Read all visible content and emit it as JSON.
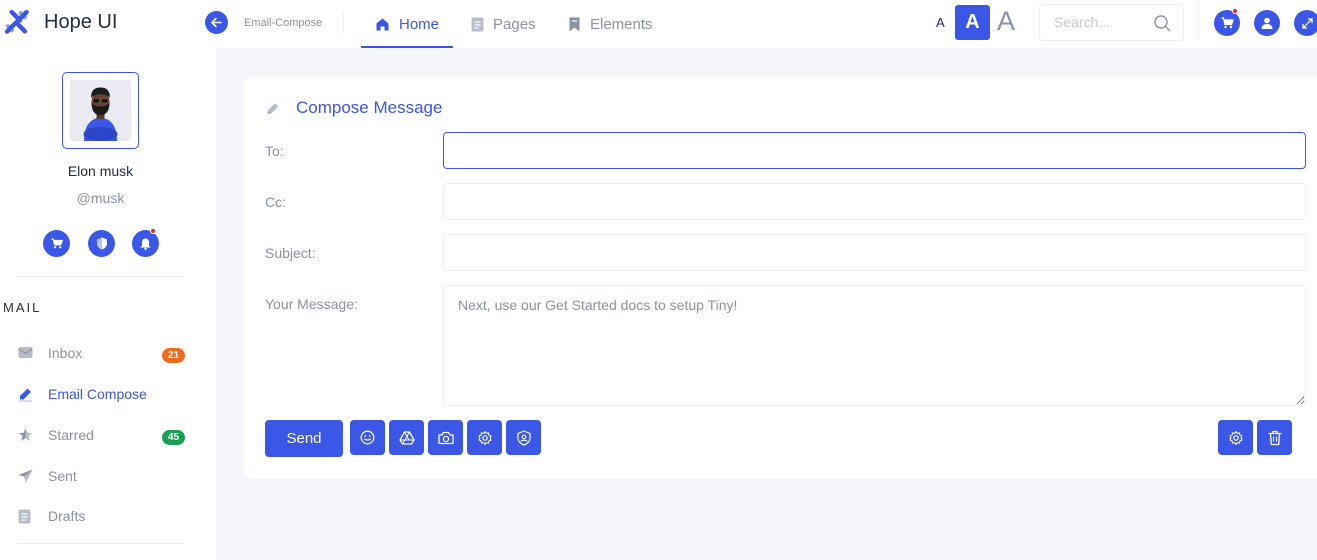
{
  "header": {
    "brand": "Hope UI",
    "breadcrumb": "Email-Compose",
    "tabs": [
      {
        "label": "Home",
        "active": true
      },
      {
        "label": "Pages",
        "active": false
      },
      {
        "label": "Elements",
        "active": false
      }
    ],
    "font_sizes": [
      "A",
      "A",
      "A"
    ],
    "search_placeholder": "Search..."
  },
  "profile": {
    "name": "Elon musk",
    "handle": "@musk"
  },
  "mail": {
    "heading": "MAIL",
    "items": [
      {
        "label": "Inbox",
        "icon": "inbox-icon",
        "badge": "21",
        "badge_color": "#f16a1b",
        "active": false
      },
      {
        "label": "Email Compose",
        "icon": "pen-icon",
        "active": true
      },
      {
        "label": "Starred",
        "icon": "star-icon",
        "badge": "45",
        "badge_color": "#1aa053",
        "active": false
      },
      {
        "label": "Sent",
        "icon": "send-icon",
        "active": false
      },
      {
        "label": "Drafts",
        "icon": "draft-icon",
        "active": false
      }
    ]
  },
  "compose": {
    "title": "Compose Message",
    "fields": {
      "to_label": "To:",
      "cc_label": "Cc:",
      "subject_label": "Subject:",
      "message_label": "Your Message:",
      "to_value": "",
      "cc_value": "",
      "subject_value": "",
      "message_placeholder": "Next, use our Get Started docs to setup Tiny!"
    },
    "send_label": "Send"
  },
  "colors": {
    "primary": "#3a57e8",
    "text_dark": "#232d42",
    "text_muted": "#8a92a6",
    "notification": "#e82626"
  }
}
